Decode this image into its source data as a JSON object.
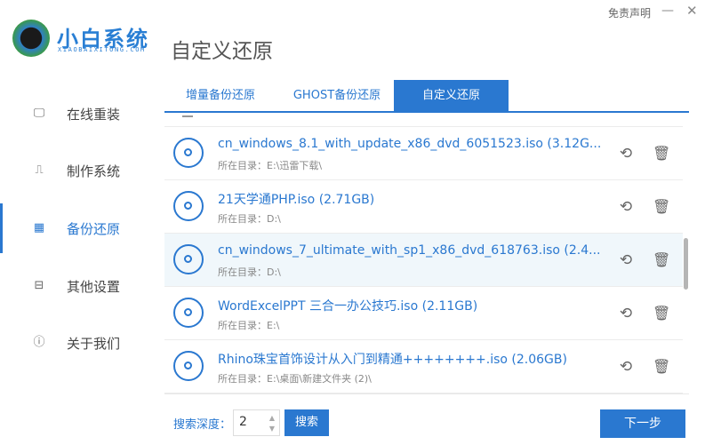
{
  "brand": {
    "name": "小白系统",
    "sub": "XIAOBAIXITONG.COM"
  },
  "header": {
    "title": "自定义还原",
    "disclaimer": "免责声明",
    "minimize": "—",
    "close": "✕"
  },
  "sidebar": {
    "items": [
      {
        "label": "在线重装",
        "icon": "monitor-icon",
        "glyph": "🖵"
      },
      {
        "label": "制作系统",
        "icon": "usb-icon",
        "glyph": "⎍"
      },
      {
        "label": "备份还原",
        "icon": "grid-icon",
        "glyph": "▦"
      },
      {
        "label": "其他设置",
        "icon": "briefcase-icon",
        "glyph": "⊟"
      },
      {
        "label": "关于我们",
        "icon": "info-icon",
        "glyph": "ⓘ"
      }
    ],
    "active": 2
  },
  "tabs": [
    {
      "label": "增量备份还原"
    },
    {
      "label": "GHOST备份还原"
    },
    {
      "label": "自定义还原"
    }
  ],
  "list": [
    {
      "name": "cn_windows_8.1_with_update_x86_dvd_6051523.iso (3.12G...",
      "path": "所在目录：E:\\迅雷下载\\"
    },
    {
      "name": "21天学通PHP.iso (2.71GB)",
      "path": "所在目录：D:\\"
    },
    {
      "name": "cn_windows_7_ultimate_with_sp1_x86_dvd_618763.iso (2.4...",
      "path": "所在目录：D:\\"
    },
    {
      "name": "WordExcelPPT 三合一办公技巧.iso (2.11GB)",
      "path": "所在目录：E:\\"
    },
    {
      "name": "Rhino珠宝首饰设计从入门到精通++++++++.iso (2.06GB)",
      "path": "所在目录：E:\\桌面\\新建文件夹 (2)\\"
    }
  ],
  "footer": {
    "depth_label": "搜索深度：",
    "depth_value": "2",
    "search": "搜索",
    "next": "下一步"
  },
  "icons": {
    "restore": "⟲",
    "trash": "🗑"
  }
}
